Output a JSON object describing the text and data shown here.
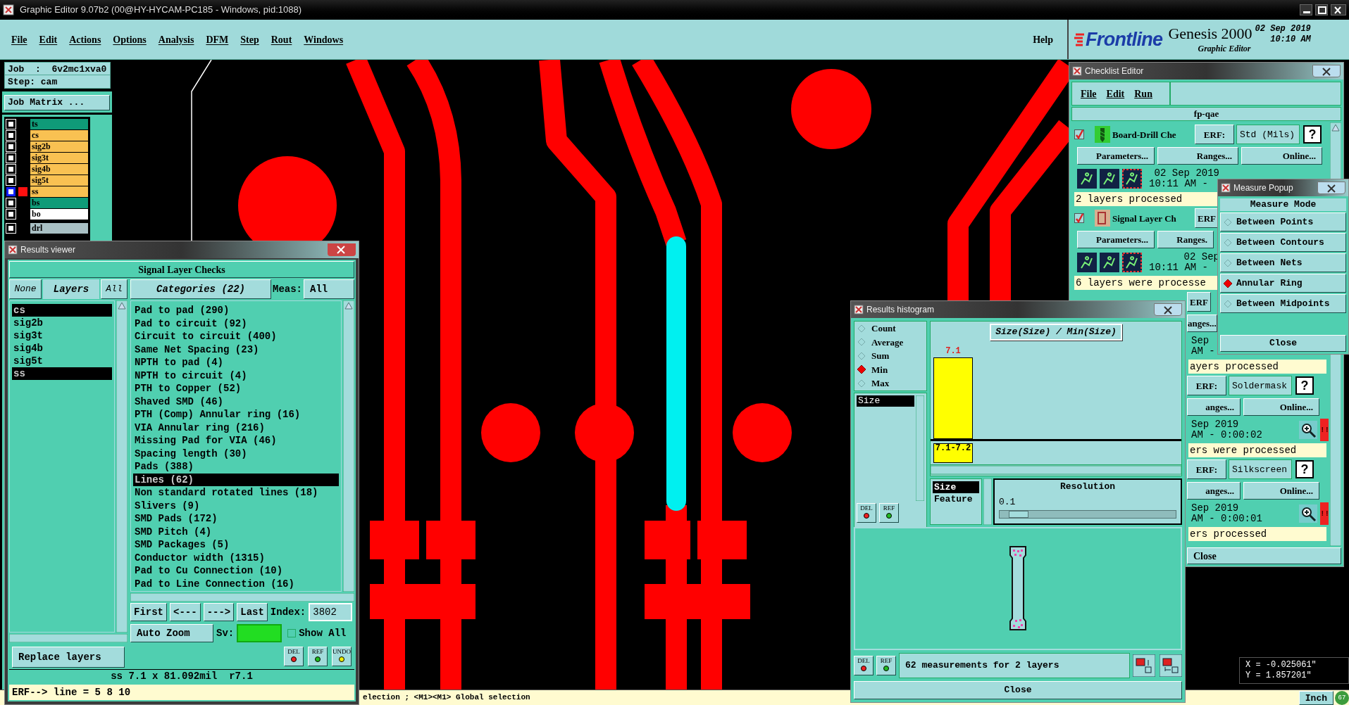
{
  "window": {
    "title": "Graphic Editor 9.07b2 (00@HY-HYCAM-PC185 - Windows, pid:1088)"
  },
  "menu": [
    "File",
    "Edit",
    "Actions",
    "Options",
    "Analysis",
    "DFM",
    "Step",
    "Rout",
    "Windows"
  ],
  "help": "Help",
  "brand": {
    "logo": "Frontline",
    "product": "Genesis 2000",
    "subtitle": "Graphic Editor",
    "date": "02 Sep 2019",
    "time": "10:10 AM"
  },
  "job": {
    "job": "Job  :  6v2mc1xva0",
    "step": "Step: cam",
    "matrix_button": "Job Matrix ..."
  },
  "layers": [
    {
      "name": "ts",
      "color": "#0f9b78",
      "checked": false,
      "active": false
    },
    {
      "name": "cs",
      "color": "#f9c152",
      "checked": false,
      "active": false
    },
    {
      "name": "sig2b",
      "color": "#f9c152",
      "checked": false,
      "active": false
    },
    {
      "name": "sig3t",
      "color": "#f9c152",
      "checked": false,
      "active": false
    },
    {
      "name": "sig4b",
      "color": "#f9c152",
      "checked": false,
      "active": false
    },
    {
      "name": "sig5t",
      "color": "#f9c152",
      "checked": false,
      "active": false
    },
    {
      "name": "ss",
      "color": "#f9c152",
      "checked": false,
      "active": true
    },
    {
      "name": "bs",
      "color": "#0f9b78",
      "checked": false,
      "active": false
    },
    {
      "name": "bo",
      "color": "#ffffff",
      "checked": false,
      "active": false
    },
    {
      "name": "drl",
      "color": "#a9c0c4",
      "checked": false,
      "active": false
    }
  ],
  "results_viewer": {
    "title": "Results viewer",
    "heading": "Signal Layer Checks",
    "none_button": "None",
    "layers_label": "Layers",
    "all_button": "All",
    "categories_label": "Categories (22)",
    "meas_label": "Meas:",
    "meas_value": "All",
    "layer_list": [
      {
        "name": "cs",
        "selected": true
      },
      {
        "name": "sig2b",
        "selected": false
      },
      {
        "name": "sig3t",
        "selected": false
      },
      {
        "name": "sig4b",
        "selected": false
      },
      {
        "name": "sig5t",
        "selected": false
      },
      {
        "name": "ss",
        "selected": true
      }
    ],
    "categories": [
      {
        "name": "Pad to pad (290)",
        "selected": false
      },
      {
        "name": "Pad to circuit (92)",
        "selected": false
      },
      {
        "name": "Circuit to circuit (400)",
        "selected": false
      },
      {
        "name": "Same Net Spacing (23)",
        "selected": false
      },
      {
        "name": "NPTH to pad (4)",
        "selected": false
      },
      {
        "name": "NPTH to circuit (4)",
        "selected": false
      },
      {
        "name": "PTH to Copper (52)",
        "selected": false
      },
      {
        "name": "Shaved SMD (46)",
        "selected": false
      },
      {
        "name": "PTH (Comp) Annular ring (16)",
        "selected": false
      },
      {
        "name": "VIA Annular ring (216)",
        "selected": false
      },
      {
        "name": "Missing Pad for VIA (46)",
        "selected": false
      },
      {
        "name": "Spacing length (30)",
        "selected": false
      },
      {
        "name": "Pads (388)",
        "selected": false
      },
      {
        "name": "Lines (62)",
        "selected": true
      },
      {
        "name": "Non standard rotated lines (18)",
        "selected": false
      },
      {
        "name": "Slivers (9)",
        "selected": false
      },
      {
        "name": "SMD Pads (172)",
        "selected": false
      },
      {
        "name": "SMD Pitch (4)",
        "selected": false
      },
      {
        "name": "SMD Packages (5)",
        "selected": false
      },
      {
        "name": "Conductor width (1315)",
        "selected": false
      },
      {
        "name": "Pad to Cu Connection (10)",
        "selected": false
      },
      {
        "name": "Pad to Line Connection (16)",
        "selected": false
      }
    ],
    "nav": [
      "First",
      "<---",
      "--->",
      "Last"
    ],
    "index_label": "Index:",
    "index_value": "3802",
    "zoom_mode": "Auto Zoom",
    "sv_label": "Sv:",
    "show_all": {
      "label": "Show All",
      "checked": false
    },
    "replace_mode": "Replace layers",
    "tools": [
      "DEL",
      "REF",
      "UNDO"
    ],
    "info": "ss 7.1 x 81.092mil  r7.1",
    "erf": "ERF--> line = 5 8 10"
  },
  "histogram": {
    "title": "Results histogram",
    "modes": [
      {
        "label": "Count",
        "selected": false
      },
      {
        "label": "Average",
        "selected": false
      },
      {
        "label": "Sum",
        "selected": false
      },
      {
        "label": "Min",
        "selected": true
      },
      {
        "label": "Max",
        "selected": false
      }
    ],
    "fields": [
      {
        "name": "Size",
        "selected": true
      }
    ],
    "field_tools": [
      "DEL",
      "REF"
    ],
    "chart": {
      "title": "Size(Size) / Min(Size)",
      "bars": [
        {
          "label": "7.1",
          "bin": "7.1-7.2"
        }
      ]
    },
    "group_by": [
      {
        "name": "Size",
        "selected": true
      },
      {
        "name": "Feature",
        "selected": false
      }
    ],
    "resolution_label": "Resolution",
    "resolution": "0.1",
    "resolution_slider": {
      "level": 0.05
    },
    "footer_tools": [
      "DEL",
      "REF"
    ],
    "summary": "62 measurements for 2 layers",
    "close": "Close"
  },
  "checklist": {
    "title": "Checklist Editor",
    "menu": [
      "File",
      "Edit",
      "Run"
    ],
    "name": "fp-qae",
    "checks": [
      {
        "kind": "full",
        "checked": true,
        "name": "Board-Drill Che",
        "erf_label": "ERF:",
        "erf": "Std (Mils)",
        "help": "?",
        "buttons": [
          "Parameters...",
          "Ranges...",
          "Online..."
        ],
        "date": "02 Sep 2019",
        "time": "10:11 AM -",
        "status": "2 layers processed"
      },
      {
        "kind": "full",
        "checked": true,
        "name": "Signal Layer Ch",
        "erf_label": "ERF",
        "buttons": [
          "Parameters...",
          "Ranges."
        ],
        "date": "02 Sep",
        "time": "10:11 AM -",
        "status": "6 layers were processe"
      },
      {
        "kind": "partial",
        "erf_label": "ERF",
        "buttons": [
          "anges..."
        ],
        "date": "Sep",
        "time": "AM -",
        "status": "ayers processed"
      },
      {
        "kind": "partial",
        "erf_label": "ERF:",
        "erf": "Soldermask",
        "help": "?",
        "buttons": [
          "anges...",
          "Online..."
        ],
        "date": "Sep 2019",
        "time": "AM - 0:00:02",
        "status": "ers were processed",
        "alert": "!!"
      },
      {
        "kind": "partial",
        "erf_label": "ERF:",
        "erf": "Silkscreen",
        "help": "?",
        "buttons": [
          "anges...",
          "Online..."
        ],
        "date": "Sep 2019",
        "time": "AM - 0:00:01",
        "status": "ers processed",
        "alert": "!!"
      }
    ],
    "close": "Close"
  },
  "measure_popup": {
    "title": "Measure Popup",
    "heading": "Measure Mode",
    "options": [
      {
        "label": "Between Points",
        "selected": false
      },
      {
        "label": "Between Contours",
        "selected": false
      },
      {
        "label": "Between Nets",
        "selected": false
      },
      {
        "label": "Annular Ring",
        "selected": true
      },
      {
        "label": "Between Midpoints",
        "selected": false
      }
    ],
    "close": "Close"
  },
  "coordinates": {
    "x": "X = -0.025061\"",
    "y": "Y = 1.857201\""
  },
  "status_bar": {
    "message": "election ; <M1><M1> Global selection",
    "units": "Inch",
    "badge": "67"
  }
}
